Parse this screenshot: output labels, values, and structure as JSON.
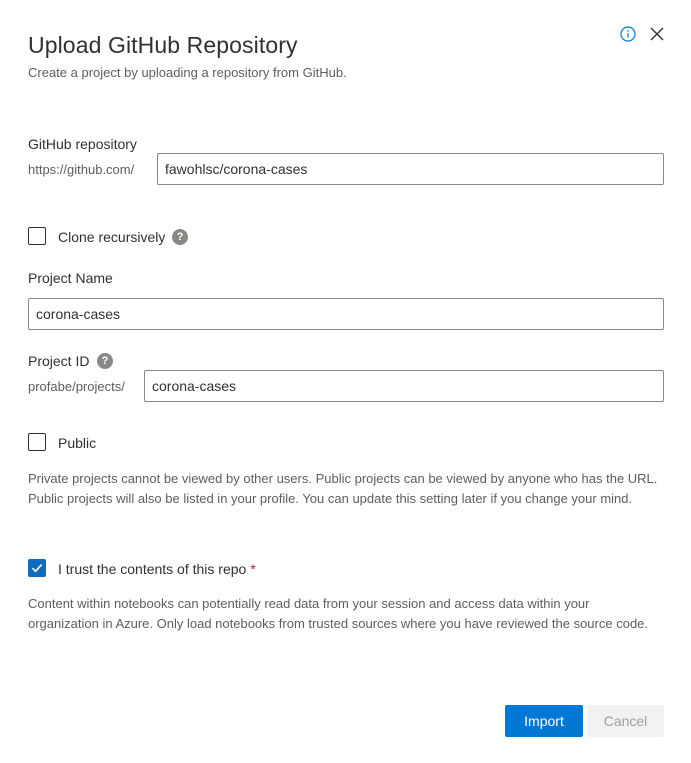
{
  "dialog": {
    "title": "Upload GitHub Repository",
    "subtitle": "Create a project by uploading a repository from GitHub.",
    "info_icon": "info-icon",
    "close_icon": "close-icon"
  },
  "github_repo": {
    "label": "GitHub repository",
    "prefix": "https://github.com/",
    "value": "fawohlsc/corona-cases"
  },
  "clone_recursively": {
    "label": "Clone recursively",
    "checked": false,
    "help_icon": "help-icon",
    "help_glyph": "?"
  },
  "project_name": {
    "label": "Project Name",
    "value": "corona-cases"
  },
  "project_id": {
    "label": "Project ID",
    "prefix": "profabe/projects/",
    "value": "corona-cases",
    "help_icon": "help-icon",
    "help_glyph": "?"
  },
  "public": {
    "label": "Public",
    "checked": false,
    "description": "Private projects cannot be viewed by other users. Public projects can be viewed by anyone who has the URL. Public projects will also be listed in your profile. You can update this setting later if you change your mind."
  },
  "trust": {
    "label": "I trust the contents of this repo",
    "required_mark": "*",
    "checked": true,
    "description": "Content within notebooks can potentially read data from your session and access data within your organization in Azure. Only load notebooks from trusted sources where you have reviewed the source code."
  },
  "buttons": {
    "import_label": "Import",
    "cancel_label": "Cancel"
  },
  "colors": {
    "accent": "#0078d4",
    "checkbox_checked": "#0f6cbd",
    "required": "#a4262c",
    "secondary_text": "#605e5c"
  }
}
